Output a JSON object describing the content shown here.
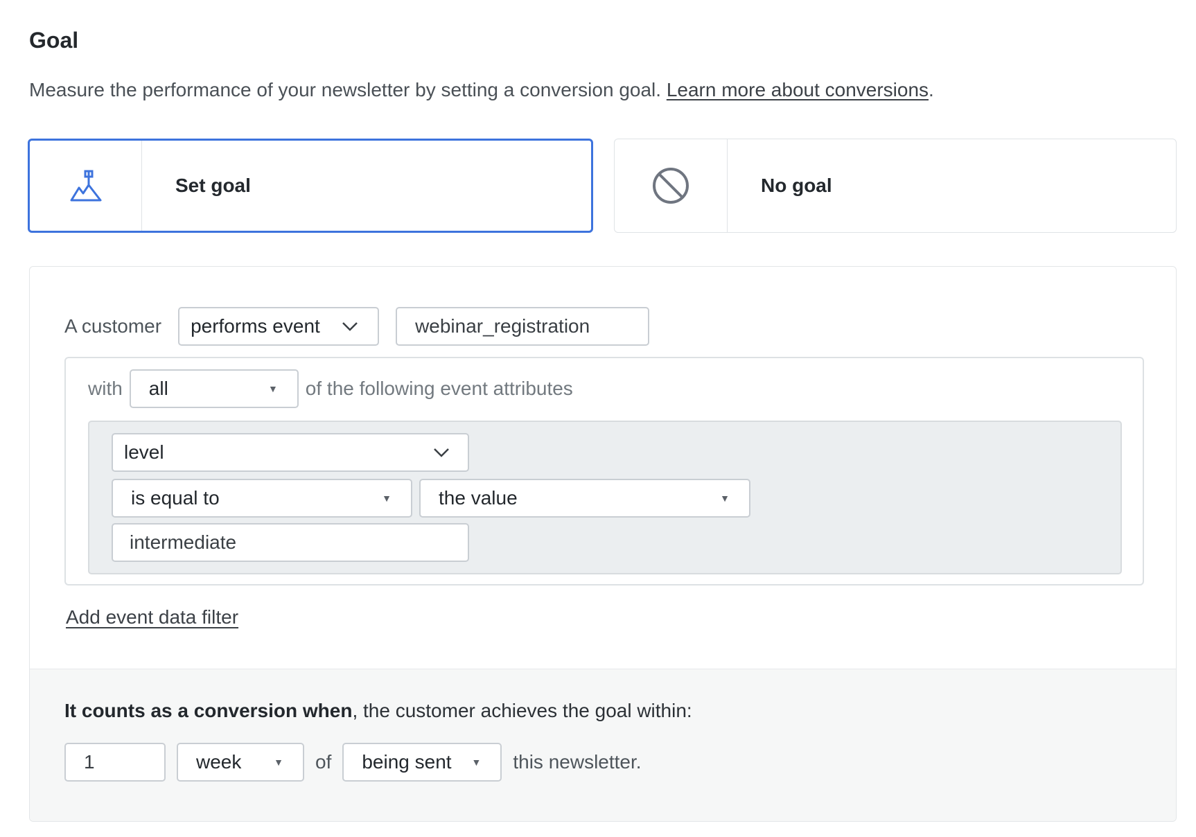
{
  "header": {
    "title": "Goal",
    "description": "Measure the performance of your newsletter by setting a conversion goal.",
    "learn_more_link": "Learn more about conversions",
    "period": "."
  },
  "options": {
    "set_goal_label": "Set goal",
    "set_goal_icon": "mountain-flag-icon",
    "no_goal_label": "No goal",
    "no_goal_icon": "prohibited-icon",
    "selected": "Set goal",
    "accent_color": "#3d73dd"
  },
  "condition": {
    "subject_label": "A customer",
    "action_select": "performs event",
    "event_name": "webinar_registration",
    "with_label": "with",
    "match_select": "all",
    "attributes_suffix": "of the following event attributes",
    "attribute": {
      "name_select": "level",
      "operator_select": "is equal to",
      "value_type_select": "the value",
      "value": "intermediate"
    },
    "add_filter_link": "Add event data filter"
  },
  "conversion": {
    "heading_bold": "It counts as a conversion when",
    "heading_rest": ", the customer achieves the goal within:",
    "amount": "1",
    "unit_select": "week",
    "of_label": "of",
    "trigger_select": "being sent",
    "suffix": "this newsletter."
  }
}
